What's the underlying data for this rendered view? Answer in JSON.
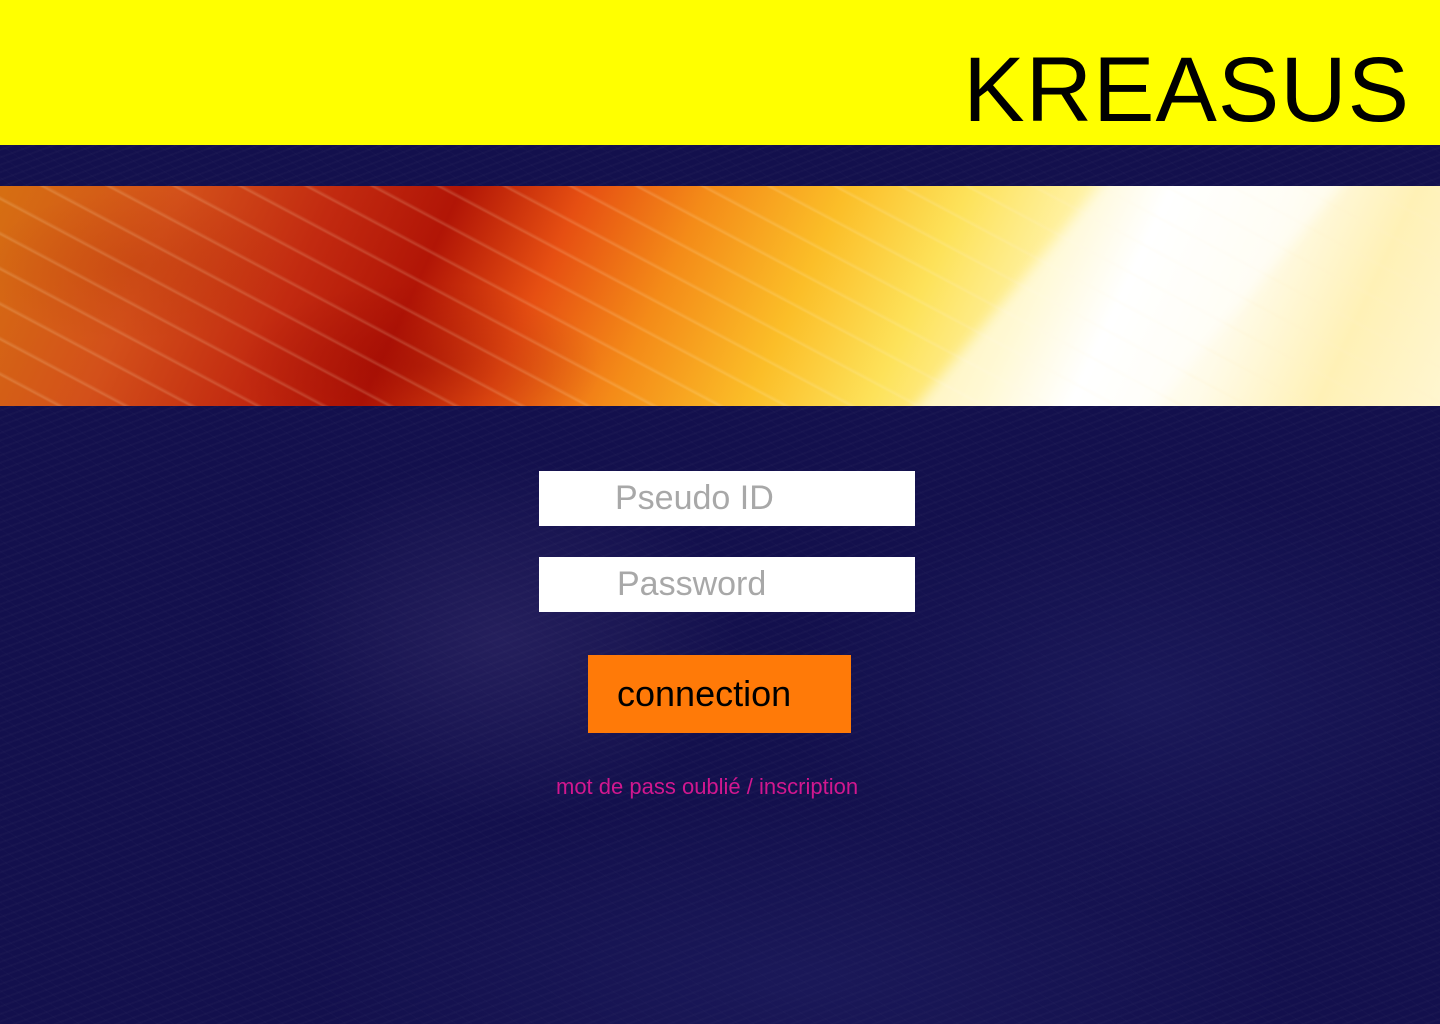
{
  "header": {
    "brand": "KREASUS",
    "background_color": "#ffff00"
  },
  "login": {
    "username_placeholder": "Pseudo ID",
    "username_value": "",
    "password_placeholder": "Password",
    "password_value": "",
    "submit_label": "connection",
    "forgot_password_link": "mot de pass oublié",
    "separator": " / ",
    "signup_link": "inscription"
  },
  "colors": {
    "page_background": "#13104d",
    "button": "#ff7a08",
    "link": "#d2178f"
  }
}
